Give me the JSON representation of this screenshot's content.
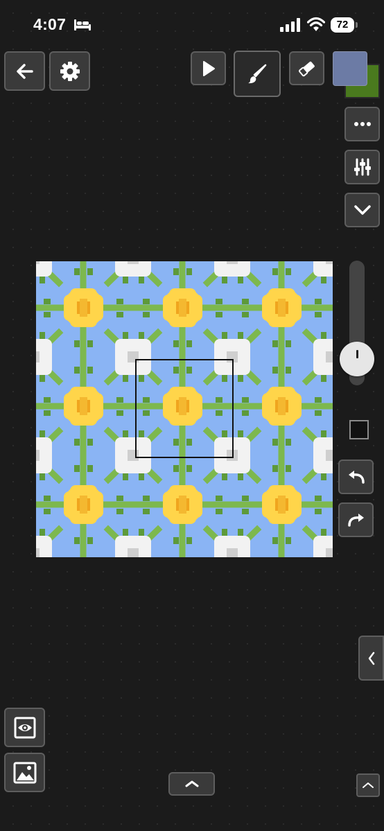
{
  "status_bar": {
    "time": "4:07",
    "battery": "72",
    "icons": [
      "bed-icon",
      "cellular-signal-icon",
      "wifi-icon",
      "battery-icon"
    ]
  },
  "toolbar": {
    "left": [
      "back-arrow-icon",
      "settings-gear-icon"
    ],
    "tools": [
      "select-pointer-icon",
      "brush-icon",
      "eraser-icon"
    ],
    "active_tool": "brush",
    "colors": {
      "primary": "#6c7ba5",
      "secondary": "#4a7a1e"
    }
  },
  "side_panel": {
    "buttons": [
      "more-icon",
      "adjust-sliders-icon",
      "chevron-down-icon"
    ]
  },
  "canvas": {
    "pattern": {
      "sky": "#8ab4f4",
      "leaf": "#7db84e",
      "leaf_dark": "#5d9a3a",
      "flower_yellow": "#ffd54a",
      "flower_center": "#f0a51e",
      "flower_white": "#f2f2f2",
      "flower_shadow": "#cfcfcf"
    },
    "selection_visible": true
  },
  "right_controls": {
    "slider_level": 0.15,
    "buttons": [
      "undo-icon",
      "redo-icon",
      "collapse-left-chevron-icon"
    ]
  },
  "bottom": {
    "buttons": [
      "preview-eye-icon",
      "image-gallery-icon",
      "expand-up-chevron-icon",
      "corner-up-chevron-icon"
    ]
  }
}
